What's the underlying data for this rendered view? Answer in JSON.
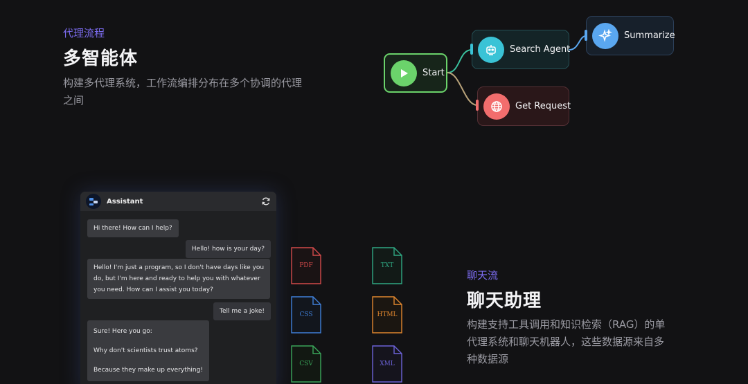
{
  "section_agents": {
    "eyebrow": "代理流程",
    "title": "多智能体",
    "description_line1": "构建多代理系统，工作流编排分布在多个协调的代理",
    "description_line2": "之间"
  },
  "flow": {
    "start": "Start",
    "search_agent": "Search Agent",
    "summarize": "Summarize",
    "get_request": "Get Request",
    "colors": {
      "start": "#6bd36b",
      "search_agent": "#3ac3d6",
      "summarize": "#5aa7f0",
      "get_request": "#f26d6d"
    },
    "icons": {
      "start": "play-icon",
      "search_agent": "robot-icon",
      "summarize": "sparkles-icon",
      "get_request": "globe-icon"
    }
  },
  "chat": {
    "title": "Assistant",
    "messages": [
      {
        "role": "assistant",
        "text": "Hi there! How can I help?"
      },
      {
        "role": "user",
        "text": "Hello! how is your day?"
      },
      {
        "role": "assistant",
        "lines": [
          "Hello! I'm just a program, so I don't have days like you",
          "do, but I'm here and ready to help you with whatever",
          "you need. How can I assist you today?"
        ]
      },
      {
        "role": "user",
        "text": "Tell me a joke!"
      },
      {
        "role": "assistant",
        "lines": [
          "Sure! Here you go:",
          "Why don't scientists trust atoms?",
          "Because they make up everything!"
        ]
      }
    ]
  },
  "files": {
    "pdf": "PDF",
    "txt": "TXT",
    "css": "CSS",
    "html": "HTML",
    "csv": "CSV",
    "xml": "XML",
    "colors": {
      "pdf": "#d24a4a",
      "txt": "#2fa883",
      "css": "#3f7fd8",
      "html": "#e0862e",
      "csv": "#3aa65a",
      "xml": "#6c63d8"
    }
  },
  "section_chat": {
    "eyebrow": "聊天流",
    "title": "聊天助理",
    "description_line1": "构建支持工具调用和知识检索（RAG）的单",
    "description_line2": "代理系统和聊天机器人，这些数据源来自多",
    "description_line3": "种数据源"
  }
}
